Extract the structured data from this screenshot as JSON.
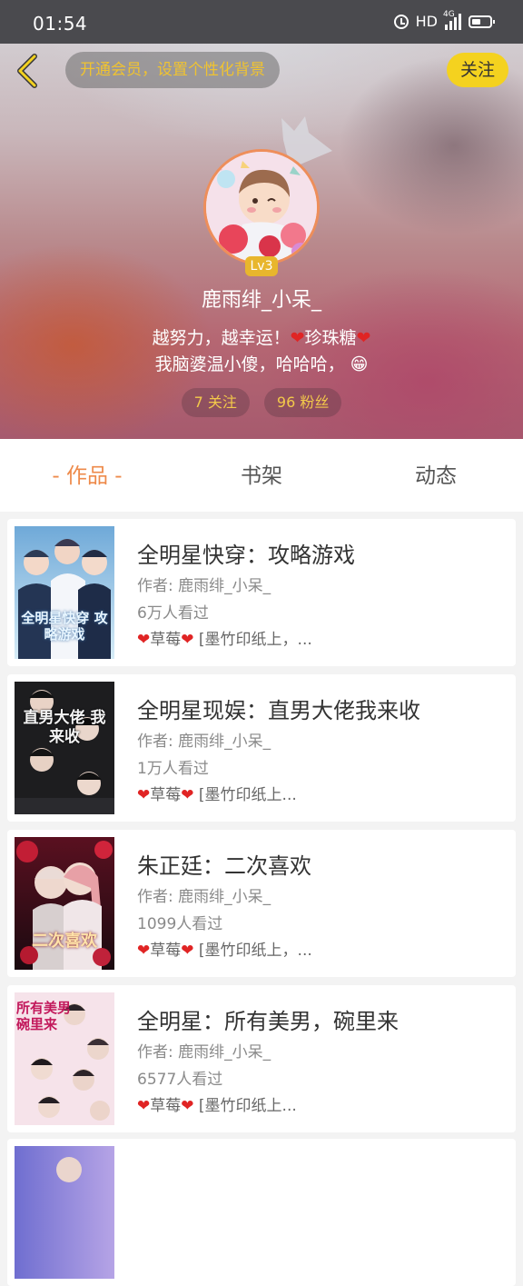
{
  "status_bar": {
    "time": "01:54",
    "network": "HD",
    "signal_label": "4G"
  },
  "header": {
    "vip_prompt": "开通会员，设置个性化背景",
    "follow_label": "关注"
  },
  "profile": {
    "level": "Lv3",
    "username": "鹿雨绯_小呆_",
    "bio_line1_text": "越努力，越幸运！",
    "bio_line1_heart": "❤",
    "bio_line1_name": "珍珠糖",
    "bio_line2_text": "我脑婆温小傻，哈哈哈，",
    "bio_line2_emoji": "😁",
    "following": "7 关注",
    "followers": "96 粉丝"
  },
  "tabs": [
    {
      "label": "- 作品 -",
      "active": true
    },
    {
      "label": "书架",
      "active": false
    },
    {
      "label": "动态",
      "active": false
    }
  ],
  "books": [
    {
      "title": "全明星快穿：攻略游戏",
      "author": "作者: 鹿雨绯_小呆_",
      "views": "6万人看过",
      "desc": "❤草莓❤ [墨竹印纸上，...",
      "cover_text": "全明星快穿 攻略游戏"
    },
    {
      "title": "全明星现娱：直男大佬我来收",
      "author": "作者: 鹿雨绯_小呆_",
      "views": "1万人看过",
      "desc": "❤草莓❤ [墨竹印纸上...",
      "cover_text": "直男大佬 我来收"
    },
    {
      "title": "朱正廷：二次喜欢",
      "author": "作者: 鹿雨绯_小呆_",
      "views": "1099人看过",
      "desc": "❤草莓❤ [墨竹印纸上，...",
      "cover_text": "二次喜欢"
    },
    {
      "title": "全明星：所有美男，碗里来",
      "author": "作者: 鹿雨绯_小呆_",
      "views": "6577人看过",
      "desc": "❤草莓❤ [墨竹印纸上...",
      "cover_text": "所有美男 碗里来"
    }
  ],
  "colors": {
    "accent": "#ee8a4a",
    "follow_yellow": "#f4d21f",
    "vip_gold": "#f0c330",
    "stat_gold": "#f3c94a",
    "level_badge": "#e8b62d"
  }
}
